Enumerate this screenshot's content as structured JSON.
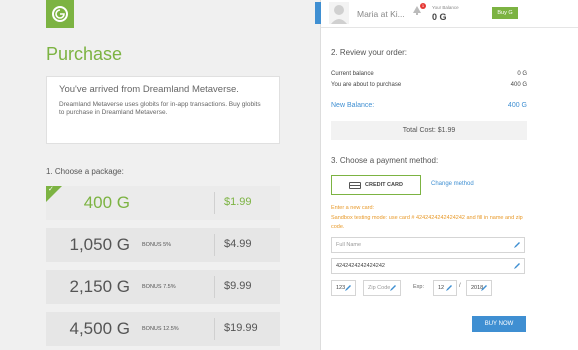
{
  "header": {
    "user_name": "Maria at Ki...",
    "notification_count": "1",
    "balance_label": "Your Balance",
    "balance_value": "0 G",
    "buy_label": "Buy G"
  },
  "purchase": {
    "title": "Purchase",
    "welcome_title": "You've arrived from Dreamland Metaverse.",
    "welcome_desc": "Dreamland Metaverse uses globits for in-app transactions. Buy globits to purchase in Dreamland Metaverse.",
    "choose_package_label": "1. Choose a package:",
    "packages": [
      {
        "amount": "400 G",
        "bonus": "",
        "price": "$1.99",
        "selected": true
      },
      {
        "amount": "1,050 G",
        "bonus": "BONUS 5%",
        "price": "$4.99",
        "selected": false
      },
      {
        "amount": "2,150 G",
        "bonus": "BONUS 7.5%",
        "price": "$9.99",
        "selected": false
      },
      {
        "amount": "4,500 G",
        "bonus": "BONUS 12.5%",
        "price": "$19.99",
        "selected": false
      }
    ]
  },
  "review": {
    "title": "2. Review your order:",
    "current_balance_label": "Current balance",
    "current_balance_value": "0 G",
    "about_to_purchase_label": "You are about to purchase",
    "about_to_purchase_value": "400 G",
    "new_balance_label": "New Balance:",
    "new_balance_value": "400 G",
    "total_cost": "Total Cost:  $1.99"
  },
  "payment": {
    "title": "3. Choose a payment method:",
    "credit_card_label": "CREDIT CARD",
    "change_method_label": "Change method",
    "enter_card_label": "Enter a new card:",
    "sandbox_note": "Sandbox testing mode: use card # 4242424242424242 and fill in name and zip code.",
    "full_name_placeholder": "Full Name",
    "card_number_value": "4242424242424242",
    "cvc_value": "123",
    "zip_placeholder": "Zip Code",
    "exp_label": "Exp:",
    "exp_month": "12",
    "exp_year": "2018",
    "buy_now_label": "BUY NOW"
  },
  "colors": {
    "green": "#7cb342",
    "blue": "#3f8fd2",
    "orange": "#e89a2b"
  }
}
